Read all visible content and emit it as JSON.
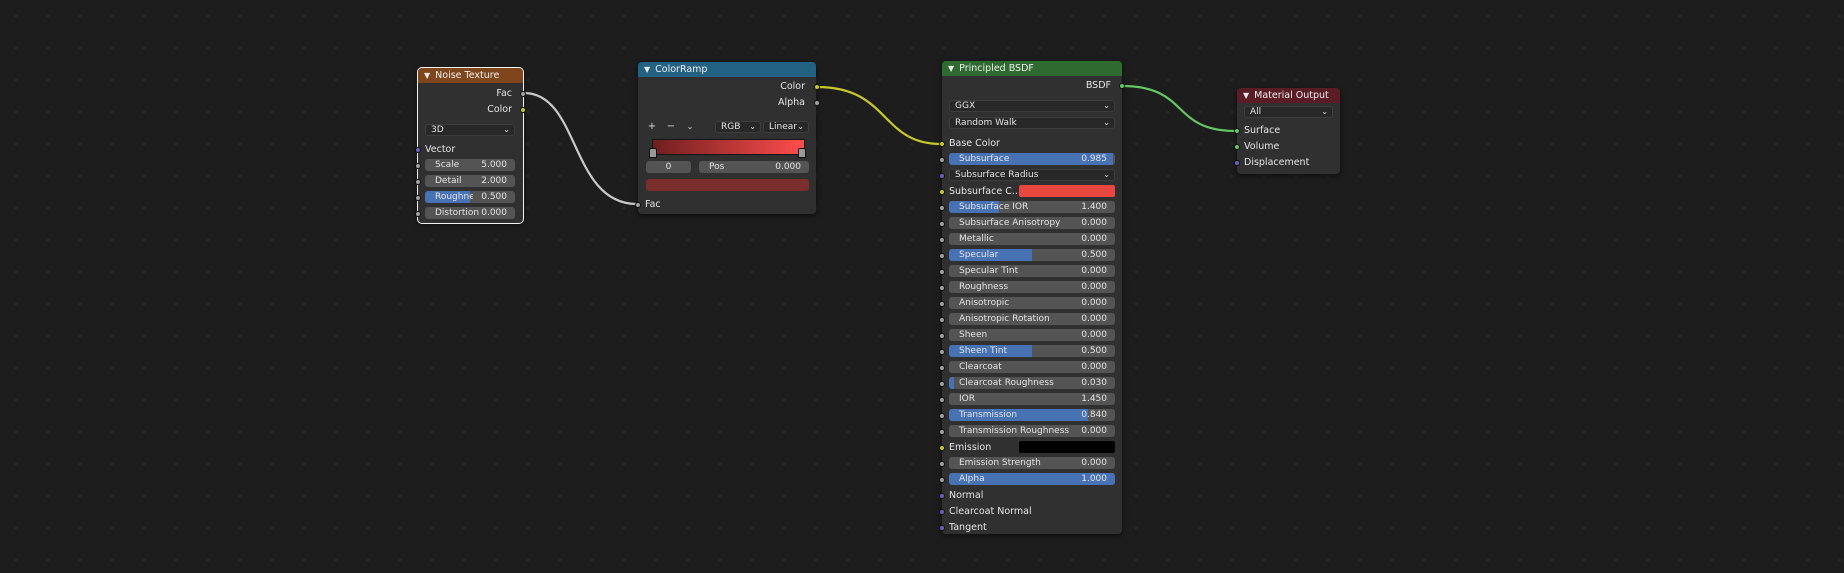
{
  "colors": {
    "background": "#1d1d1d",
    "node_body": "#303030",
    "texture_header": "#80461b",
    "converter_header": "#246283",
    "shader_header": "#2f6b30",
    "output_header": "#5a1c25",
    "slider_fill": "#4772b3",
    "socket_float": "#a1a1a1",
    "socket_color": "#c7c729",
    "socket_vector": "#6363c7",
    "socket_shader": "#63c763",
    "link_gray": "#c8c8c8",
    "link_yellow": "#c7c729",
    "link_green": "#63c763"
  },
  "noise_texture": {
    "title": "Noise Texture",
    "outputs": [
      "Fac",
      "Color"
    ],
    "dimensions": "3D",
    "vector_label": "Vector",
    "fields": [
      {
        "label": "Scale",
        "value": "5.000"
      },
      {
        "label": "Detail",
        "value": "2.000"
      },
      {
        "label": "Roughness",
        "value": "0.500",
        "fill": 0.5
      },
      {
        "label": "Distortion",
        "value": "0.000"
      }
    ]
  },
  "color_ramp": {
    "title": "ColorRamp",
    "outputs": [
      "Color",
      "Alpha"
    ],
    "add_icon": "plus-icon",
    "remove_icon": "minus-icon",
    "menu_icon": "chevron-down-icon",
    "color_mode": "RGB",
    "interpolation": "Linear",
    "stop_index": "0",
    "pos_label": "Pos",
    "pos_value": "0.000",
    "gradient_start": "#6f1f1f",
    "gradient_end": "#ff4d4d",
    "stop_color": "#7a2f2c",
    "input_label": "Fac"
  },
  "principled_bsdf": {
    "title": "Principled BSDF",
    "output": "BSDF",
    "distribution": "GGX",
    "subsurface_method": "Random Walk",
    "base_color_label": "Base Color",
    "subsurface_radius_label": "Subsurface Radius",
    "subsurface_color_label": "Subsurface C...",
    "subsurface_color": "#e8473f",
    "emission_label": "Emission",
    "emission_color": "#000000",
    "fields": [
      {
        "label": "Subsurface",
        "value": "0.985",
        "fill": 0.985
      },
      {
        "label": "Subsurface IOR",
        "value": "1.400",
        "fill": 0.3
      },
      {
        "label": "Subsurface Anisotropy",
        "value": "0.000",
        "fill": 0
      },
      {
        "label": "Metallic",
        "value": "0.000",
        "fill": 0
      },
      {
        "label": "Specular",
        "value": "0.500",
        "fill": 0.5
      },
      {
        "label": "Specular Tint",
        "value": "0.000",
        "fill": 0
      },
      {
        "label": "Roughness",
        "value": "0.000",
        "fill": 0
      },
      {
        "label": "Anisotropic",
        "value": "0.000",
        "fill": 0
      },
      {
        "label": "Anisotropic Rotation",
        "value": "0.000",
        "fill": 0
      },
      {
        "label": "Sheen",
        "value": "0.000",
        "fill": 0
      },
      {
        "label": "Sheen Tint",
        "value": "0.500",
        "fill": 0.5
      },
      {
        "label": "Clearcoat",
        "value": "0.000",
        "fill": 0
      },
      {
        "label": "Clearcoat Roughness",
        "value": "0.030",
        "fill": 0.03
      },
      {
        "label": "IOR",
        "value": "1.450",
        "fill": 0
      },
      {
        "label": "Transmission",
        "value": "0.840",
        "fill": 0.84
      },
      {
        "label": "Transmission Roughness",
        "value": "0.000",
        "fill": 0
      },
      {
        "label": "Emission Strength",
        "value": "0.000",
        "fill": 0
      },
      {
        "label": "Alpha",
        "value": "1.000",
        "fill": 1
      }
    ],
    "normal_label": "Normal",
    "clearcoat_normal_label": "Clearcoat Normal",
    "tangent_label": "Tangent"
  },
  "material_output": {
    "title": "Material Output",
    "target": "All",
    "inputs": [
      "Surface",
      "Volume",
      "Displacement"
    ]
  }
}
